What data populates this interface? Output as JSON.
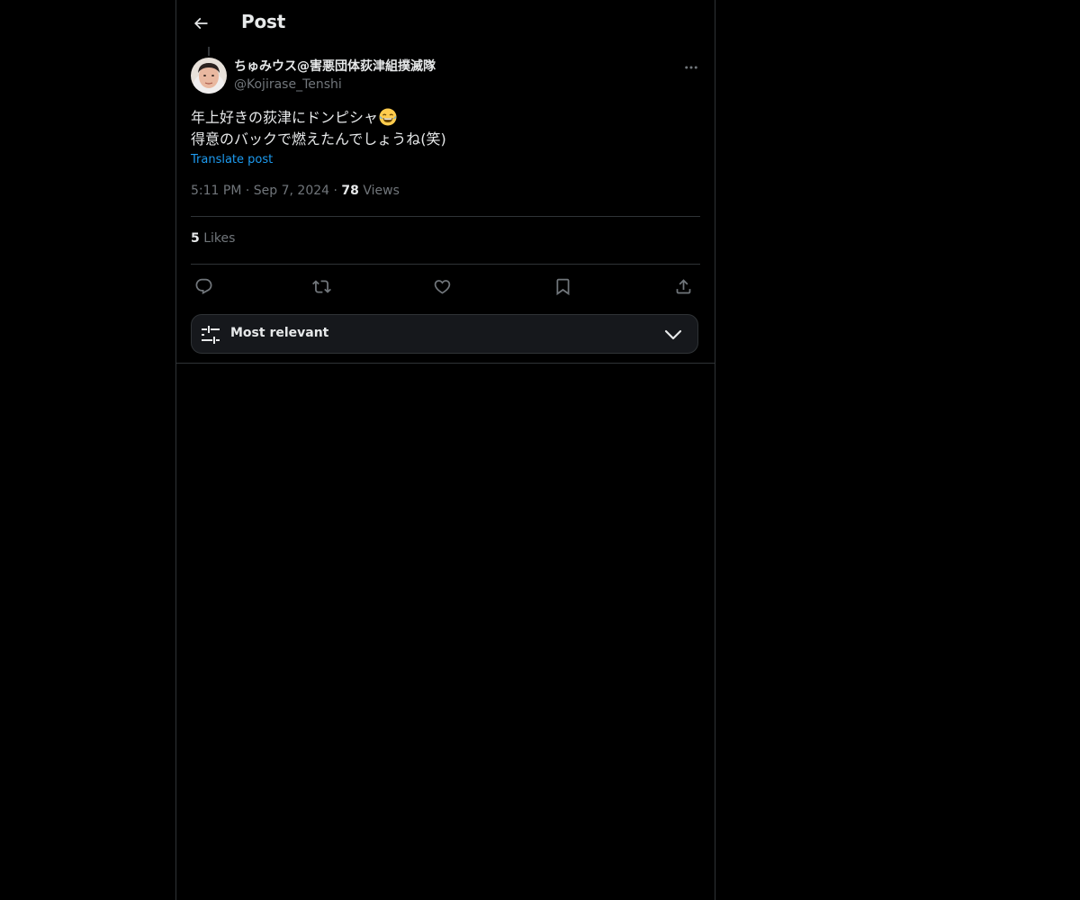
{
  "header": {
    "title": "Post"
  },
  "post": {
    "display_name": "ちゅみウス@害悪団体荻津組撲滅隊",
    "handle": "@Kojirase_Tenshi",
    "text_line1": "年上好きの荻津にドンピシャ",
    "text_line2": "得意のバックで燃えたんでしょうね(笑)",
    "emoji": "face-with-tears-of-joy",
    "translate_label": "Translate post",
    "time": "5:11 PM",
    "date": "Sep 7, 2024",
    "separator": "·",
    "views_count": "78",
    "views_label": "Views",
    "likes_count": "5",
    "likes_label": "Likes"
  },
  "sort": {
    "label": "Most relevant"
  },
  "icons": {
    "back": "back-arrow-icon",
    "more": "more-icon",
    "reply": "reply-icon",
    "repost": "repost-icon",
    "like": "heart-icon",
    "bookmark": "bookmark-icon",
    "share": "share-icon",
    "sort": "sliders-icon",
    "chevron": "chevron-down-icon"
  },
  "colors": {
    "background": "#000000",
    "text": "#e7e9ea",
    "secondary": "#71767b",
    "accent": "#1d9bf0",
    "border": "#2f3336"
  }
}
